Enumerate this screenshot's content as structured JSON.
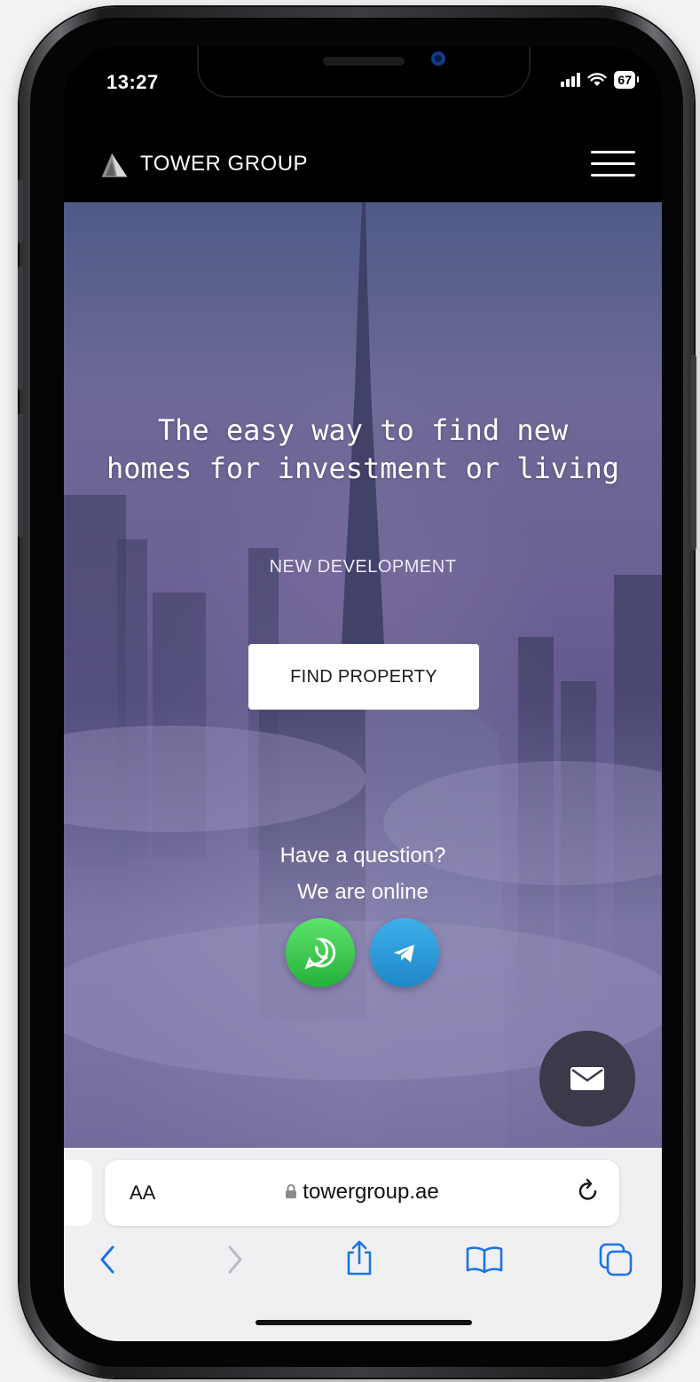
{
  "status_bar": {
    "time": "13:27",
    "battery": "67"
  },
  "header": {
    "brand": "TOWER GROUP"
  },
  "hero": {
    "title_line1": "The easy way to find new",
    "title_line2": "homes for investment or living",
    "subtitle": "NEW DEVELOPMENT",
    "cta_label": "FIND PROPERTY",
    "question_line1": "Have a question?",
    "question_line2": "We are online"
  },
  "contact": {
    "whatsapp_color": "#2fbf45",
    "telegram_color": "#2a9be0"
  },
  "browser": {
    "text_size_label": "AA",
    "url": "towergroup.ae"
  },
  "colors": {
    "accent_blue": "#1a73e8",
    "hero_purple": "#6a6294"
  }
}
